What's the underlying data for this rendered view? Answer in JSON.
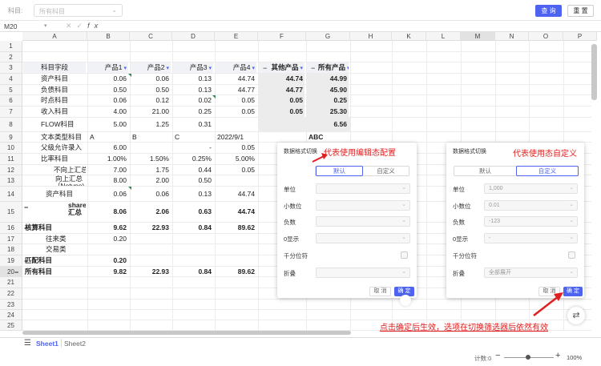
{
  "filter": {
    "label": "科目:",
    "placeholder": "所有科目",
    "query_label": "查 询",
    "reset_label": "重 置"
  },
  "formula": {
    "cell_ref": "M20",
    "fx": "fx"
  },
  "columns": [
    "A",
    "B",
    "C",
    "D",
    "E",
    "F",
    "G",
    "H",
    "K",
    "L",
    "M",
    "N",
    "O",
    "P"
  ],
  "rows": [
    "1",
    "2",
    "3",
    "4",
    "5",
    "6",
    "7",
    "8",
    "9",
    "10",
    "11",
    "12",
    "13",
    "14",
    "15",
    "16",
    "17",
    "18",
    "19",
    "20",
    "21",
    "22",
    "23",
    "24",
    "25"
  ],
  "table": {
    "header": [
      "科目字段",
      "产品1",
      "产品2",
      "产品3",
      "产品4",
      "其他产品",
      "所有产品"
    ],
    "data": [
      [
        "资产科目",
        "0.06",
        "0.06",
        "0.13",
        "44.74",
        "44.74",
        "44.99"
      ],
      [
        "负债科目",
        "0.50",
        "0.50",
        "0.13",
        "44.77",
        "44.77",
        "45.90"
      ],
      [
        "时点科目",
        "0.06",
        "0.12",
        "0.02",
        "0.05",
        "0.05",
        "0.25"
      ],
      [
        "收入科目",
        "4.00",
        "21.00",
        "0.25",
        "0.05",
        "0.05",
        "25.30"
      ],
      [
        "FLOW科目",
        "5.00",
        "1.25",
        "0.31",
        "",
        "",
        "6.56"
      ],
      [
        "文本类型科目",
        "A",
        "B",
        "C",
        "2022/9/1",
        "",
        "ABC"
      ],
      [
        "父级允许录入",
        "6.00",
        "",
        "-",
        "0.05",
        "",
        ""
      ],
      [
        "比率科目",
        "1.00%",
        "1.50%",
        "0.25%",
        "5.00%",
        "",
        ""
      ],
      [
        "不向上汇总",
        "7.00",
        "1.75",
        "0.44",
        "0.05",
        "",
        ""
      ],
      [
        "向上汇总（Notype)",
        "8.00",
        "2.00",
        "0.50",
        "",
        "",
        ""
      ],
      [
        "资产科目",
        "0.06",
        "0.06",
        "0.13",
        "44.74",
        "",
        ""
      ],
      [
        "sharemember汇总",
        "8.06",
        "2.06",
        "0.63",
        "44.74",
        "",
        ""
      ],
      [
        "核算科目",
        "9.62",
        "22.93",
        "0.84",
        "89.62",
        "",
        ""
      ],
      [
        "往来类",
        "0.20",
        "",
        "",
        "",
        "",
        ""
      ],
      [
        "交易类",
        "",
        "",
        "",
        "",
        "",
        ""
      ],
      [
        "匹配科目",
        "0.20",
        "",
        "",
        "",
        "",
        ""
      ],
      [
        "所有科目",
        "9.82",
        "22.93",
        "0.84",
        "89.62",
        "",
        ""
      ]
    ]
  },
  "panel_left": {
    "title": "数据格式切换",
    "tab_default": "默认",
    "tab_custom": "自定义",
    "fields": [
      {
        "label": "单位",
        "value": ""
      },
      {
        "label": "小数位",
        "value": ""
      },
      {
        "label": "负数",
        "value": ""
      },
      {
        "label": "0显示",
        "value": ""
      },
      {
        "label": "千分位符",
        "value": ""
      },
      {
        "label": "折叠",
        "value": ""
      }
    ],
    "cancel": "取 消",
    "ok": "确 定"
  },
  "panel_right": {
    "title": "数据格式切换",
    "tab_default": "默认",
    "tab_custom": "自定义",
    "fields": [
      {
        "label": "单位",
        "value": "1,000"
      },
      {
        "label": "小数位",
        "value": "0.01"
      },
      {
        "label": "负数",
        "value": "-123"
      },
      {
        "label": "0显示",
        "value": "-"
      },
      {
        "label": "千分位符",
        "value": ""
      },
      {
        "label": "折叠",
        "value": "全部展开"
      }
    ],
    "cancel": "取 消",
    "ok": "确 定"
  },
  "annotations": {
    "left": "代表使用编辑态配置",
    "right": "代表使用态自定义",
    "bottom": "点击确定后生效，选项在切换筛选器后依然有效"
  },
  "sheets": [
    "Sheet1",
    "Sheet2"
  ],
  "status": {
    "count": "计数:0",
    "zoom": "100%"
  },
  "colors": {
    "accent": "#4e63f0",
    "annotation": "#e02020"
  }
}
